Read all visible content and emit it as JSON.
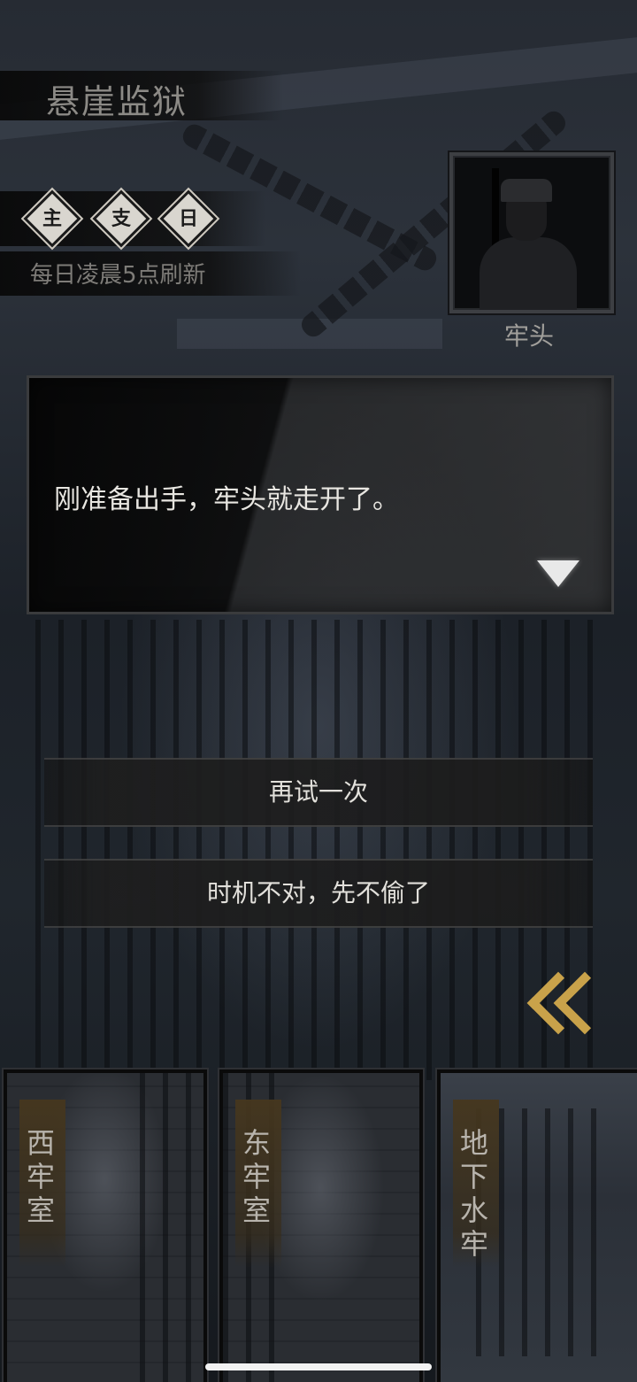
{
  "location": {
    "title": "悬崖监狱"
  },
  "quest_badges": [
    "主",
    "支",
    "日"
  ],
  "refresh_note": "每日凌晨5点刷新",
  "npc": {
    "name": "牢头"
  },
  "dialog": {
    "text": "刚准备出手，牢头就走开了。"
  },
  "options": [
    {
      "label": "再试一次"
    },
    {
      "label": "时机不对，先不偷了"
    }
  ],
  "rooms": [
    {
      "label": "西牢室"
    },
    {
      "label": "东牢室"
    },
    {
      "label": "地下水牢"
    }
  ],
  "colors": {
    "accent_gold": "#c9a24a",
    "text_light": "#e8e6e1",
    "text_dim": "#8c8a86"
  },
  "icons": {
    "continue": "triangle-down-icon",
    "back": "double-chevron-left-icon"
  }
}
